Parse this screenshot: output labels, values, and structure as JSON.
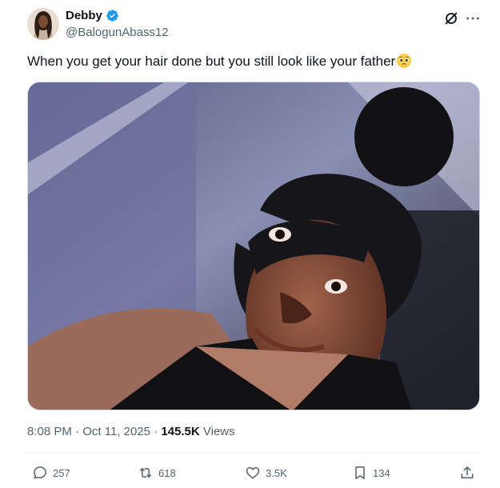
{
  "author": {
    "display_name": "Debby",
    "handle": "@BalogunAbass12",
    "verified": true,
    "avatar_icon": "profile-avatar"
  },
  "header_icons": {
    "grok": "grok-icon",
    "more": "more-icon"
  },
  "tweet": {
    "text": "When you get your hair done but you still look like your father",
    "emoji": "pleading-face-emoji"
  },
  "media": {
    "type": "photo"
  },
  "meta": {
    "time": "8:08 PM",
    "separator": "·",
    "date": "Oct 11, 2025",
    "views_count": "145.5K",
    "views_label": "Views"
  },
  "actions": {
    "replies": "257",
    "reposts": "618",
    "likes": "3.5K",
    "bookmarks": "134"
  },
  "colors": {
    "text_primary": "#0f1419",
    "text_secondary": "#536471",
    "verified_blue": "#1d9bf0",
    "divider": "#eff3f4"
  }
}
